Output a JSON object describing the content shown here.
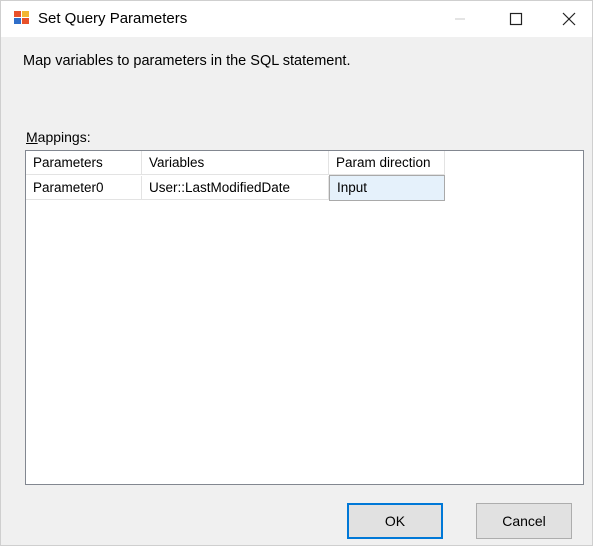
{
  "window": {
    "title": "Set Query Parameters"
  },
  "dialog": {
    "description": "Map variables to parameters in the SQL statement.",
    "mappings_label_accel": "M",
    "mappings_label_rest": "appings:"
  },
  "grid": {
    "columns": [
      "Parameters",
      "Variables",
      "Param direction"
    ],
    "rows": [
      {
        "parameter": "Parameter0",
        "variable": "User::LastModifiedDate",
        "direction": "Input"
      }
    ]
  },
  "buttons": {
    "ok": "OK",
    "cancel": "Cancel"
  },
  "colors": {
    "accent": "#0078d7",
    "selected_cell": "#e5f1fb",
    "dialog_bg": "#f0f0f0"
  },
  "icons": {
    "app": "ssis-query-icon",
    "minimize": "minimize-icon",
    "maximize": "maximize-icon",
    "close": "close-icon"
  }
}
